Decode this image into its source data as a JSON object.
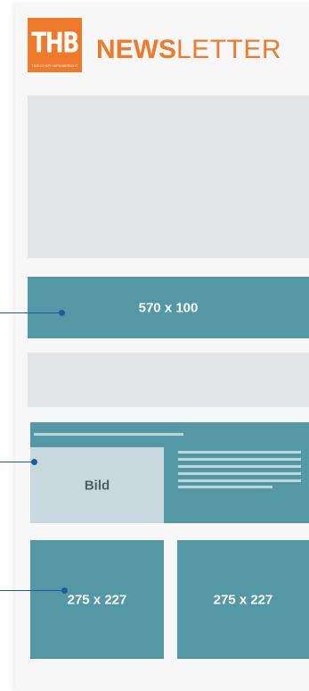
{
  "header": {
    "logo_text": "THB",
    "logo_tagline": "TÄGLICHER HAFENBERICHT",
    "title_bold": "NEWS",
    "title_light": "LETTER"
  },
  "layout_blocks": {
    "hero_label": "",
    "banner_label": "570 x 100",
    "article_image_label": "Bild",
    "tile_left_label": "275 x 227",
    "tile_right_label": "275 x 227"
  },
  "colors": {
    "brand_orange": "#f07a2b",
    "teal": "#5598a5",
    "placeholder_grey": "#e4e5e7",
    "image_placeholder": "#c7d9de",
    "connector_blue": "#1d5d9b"
  }
}
